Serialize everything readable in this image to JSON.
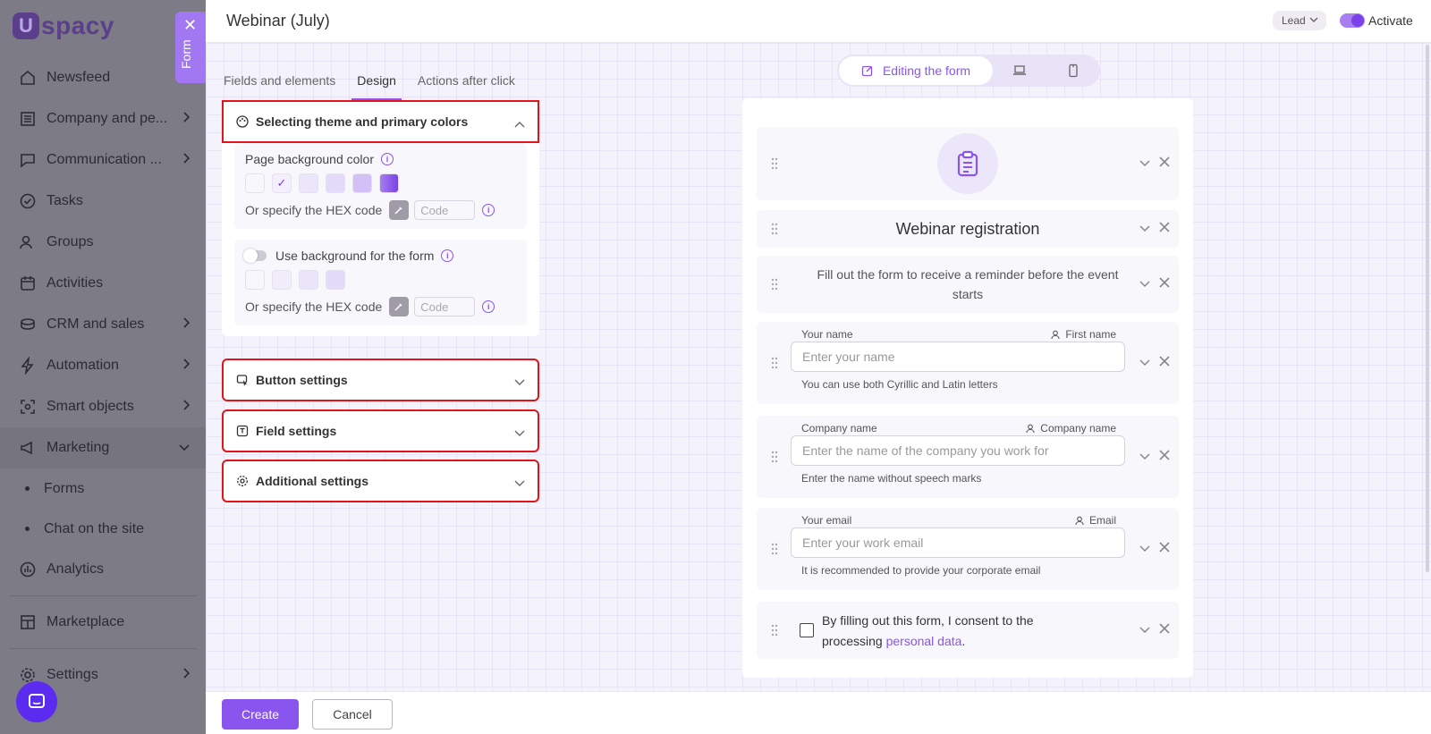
{
  "sidebar": {
    "logo_letter": "U",
    "logo_text": "spacy",
    "items": [
      {
        "label": "Newsfeed",
        "icon": "home-icon"
      },
      {
        "label": "Company and pe...",
        "icon": "table-icon"
      },
      {
        "label": "Communication ...",
        "icon": "message-icon"
      },
      {
        "label": "Tasks",
        "icon": "check-circle-icon"
      },
      {
        "label": "Groups",
        "icon": "users-icon"
      },
      {
        "label": "Activities",
        "icon": "calendar-icon"
      },
      {
        "label": "CRM and sales",
        "icon": "coins-icon"
      },
      {
        "label": "Automation",
        "icon": "lightning-icon"
      },
      {
        "label": "Smart objects",
        "icon": "smart-object-icon"
      },
      {
        "label": "Marketing",
        "icon": "megaphone-icon"
      }
    ],
    "sub_items": [
      "Forms",
      "Chat on the site"
    ],
    "bottom_items": [
      {
        "label": "Analytics",
        "icon": "chart-icon"
      },
      {
        "label": "Marketplace",
        "icon": "store-icon"
      },
      {
        "label": "Settings",
        "icon": "gear-icon"
      }
    ]
  },
  "form_tab": {
    "label": "Form",
    "close": "✕"
  },
  "header": {
    "title": "Webinar (July)",
    "entity_select": "Lead",
    "activate_label": "Activate"
  },
  "tabs": [
    "Fields and elements",
    "Design",
    "Actions after click"
  ],
  "active_tab": "Design",
  "theme_section": {
    "title": "Selecting theme and primary colors",
    "page_bg_label": "Page background color",
    "hex_label": "Or specify the HEX code",
    "code_placeholder": "Code",
    "form_bg_label": "Use background for the form",
    "hex_label_2": "Or specify the HEX code",
    "code_placeholder_2": "Code",
    "page_swatches": [
      "#f8f7fb",
      "#f3effc",
      "#ece6fb",
      "#e4dafa",
      "#d3c0f6",
      "#a97ef0"
    ],
    "form_swatches": [
      "#f8f7fb",
      "#f1edfb",
      "#ebe5fa",
      "#e3dbf8"
    ]
  },
  "sections": {
    "button": "Button settings",
    "field": "Field settings",
    "additional": "Additional settings"
  },
  "preview_switch": {
    "editing": "Editing the form"
  },
  "preview": {
    "heading": "Webinar registration",
    "description": "Fill out the form to receive a reminder before the event starts",
    "fields": [
      {
        "label": "Your name",
        "mapping": "First name",
        "placeholder": "Enter your name",
        "hint": "You can use both Cyrillic and Latin letters"
      },
      {
        "label": "Company name",
        "mapping": "Company name",
        "placeholder": "Enter the name of the company you work for",
        "hint": "Enter the name without speech marks"
      },
      {
        "label": "Your email",
        "mapping": "Email",
        "placeholder": "Enter your work email",
        "hint": "It is recommended to provide your corporate email"
      }
    ],
    "consent_text": "By filling out this form, I consent to the processing",
    "consent_link": "personal data",
    "consent_end": "."
  },
  "footer": {
    "create": "Create",
    "cancel": "Cancel"
  },
  "colors": {
    "accent": "#8a55ee",
    "highlight": "#e0141a"
  }
}
